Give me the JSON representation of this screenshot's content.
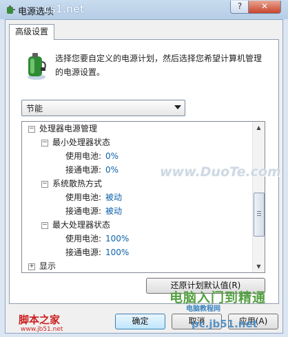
{
  "window": {
    "title": "电源选项",
    "overlay_watermark": "cs1.net",
    "help_label": "?",
    "close_label": "✕"
  },
  "tab": {
    "label": "高级设置"
  },
  "description": "选择您要自定义的电源计划，然后选择您希望计算机管理的电源设置。",
  "plan_select": {
    "value": "节能"
  },
  "tree": {
    "group_processor": "处理器电源管理",
    "min_state": "最小处理器状态",
    "min_battery_label": "使用电池:",
    "min_battery_value": "0%",
    "min_ac_label": "接通电源:",
    "min_ac_value": "0%",
    "cooling": "系统散热方式",
    "cool_battery_label": "使用电池:",
    "cool_battery_value": "被动",
    "cool_ac_label": "接通电源:",
    "cool_ac_value": "被动",
    "max_state": "最大处理器状态",
    "max_battery_label": "使用电池:",
    "max_battery_value": "100%",
    "max_ac_label": "接通电源:",
    "max_ac_value": "100%",
    "display": "显示"
  },
  "buttons": {
    "restore": "还原计划默认值(R)",
    "ok": "确定",
    "cancel": "取消",
    "apply": "应用(A)"
  },
  "watermarks": {
    "duote": "www.DuoTe.com",
    "green": "电脑入门到精通",
    "red_main": "脚本之家",
    "red_sub": "www.jb51.net",
    "mid_small": "电脑教程网",
    "mid_large": "pc.jb51.net"
  }
}
